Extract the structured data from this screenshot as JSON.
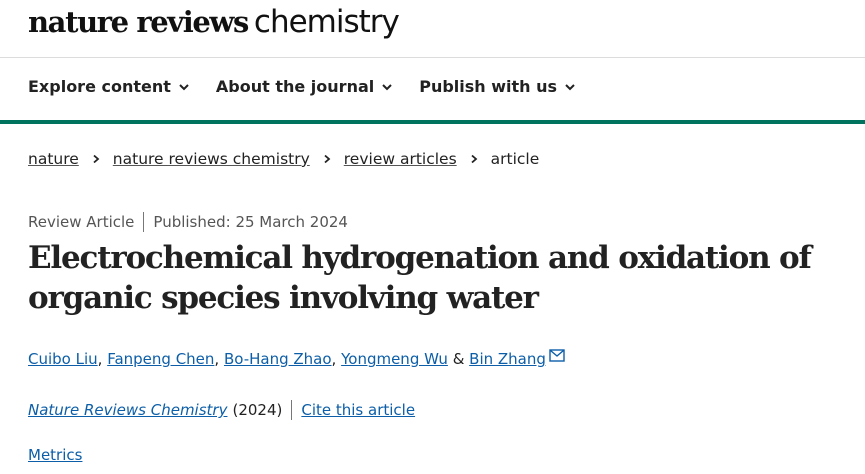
{
  "header": {
    "logo_bold": "nature reviews",
    "logo_light": "chemistry"
  },
  "nav": {
    "items": [
      {
        "label": "Explore content",
        "icon": "chevron-down-icon"
      },
      {
        "label": "About the journal",
        "icon": "chevron-down-icon"
      },
      {
        "label": "Publish with us",
        "icon": "chevron-down-icon"
      }
    ]
  },
  "colors": {
    "accent_green": "#00735e",
    "link_blue": "#0c5ea8"
  },
  "breadcrumb": {
    "items": [
      "nature",
      "nature reviews chemistry",
      "review articles"
    ],
    "current": "article"
  },
  "article": {
    "type": "Review Article",
    "published": "Published: 25 March 2024",
    "title": "Electrochemical hydrogenation and oxidation of organic species involving water",
    "authors": [
      "Cuibo Liu",
      "Fanpeng Chen",
      "Bo-Hang Zhao",
      "Yongmeng Wu",
      "Bin Zhang"
    ],
    "author_separators": [
      ", ",
      ", ",
      ", ",
      " & "
    ],
    "journal": "Nature Reviews Chemistry",
    "year": "(2024)",
    "cite_label": "Cite this article",
    "metrics_label": "Metrics"
  }
}
